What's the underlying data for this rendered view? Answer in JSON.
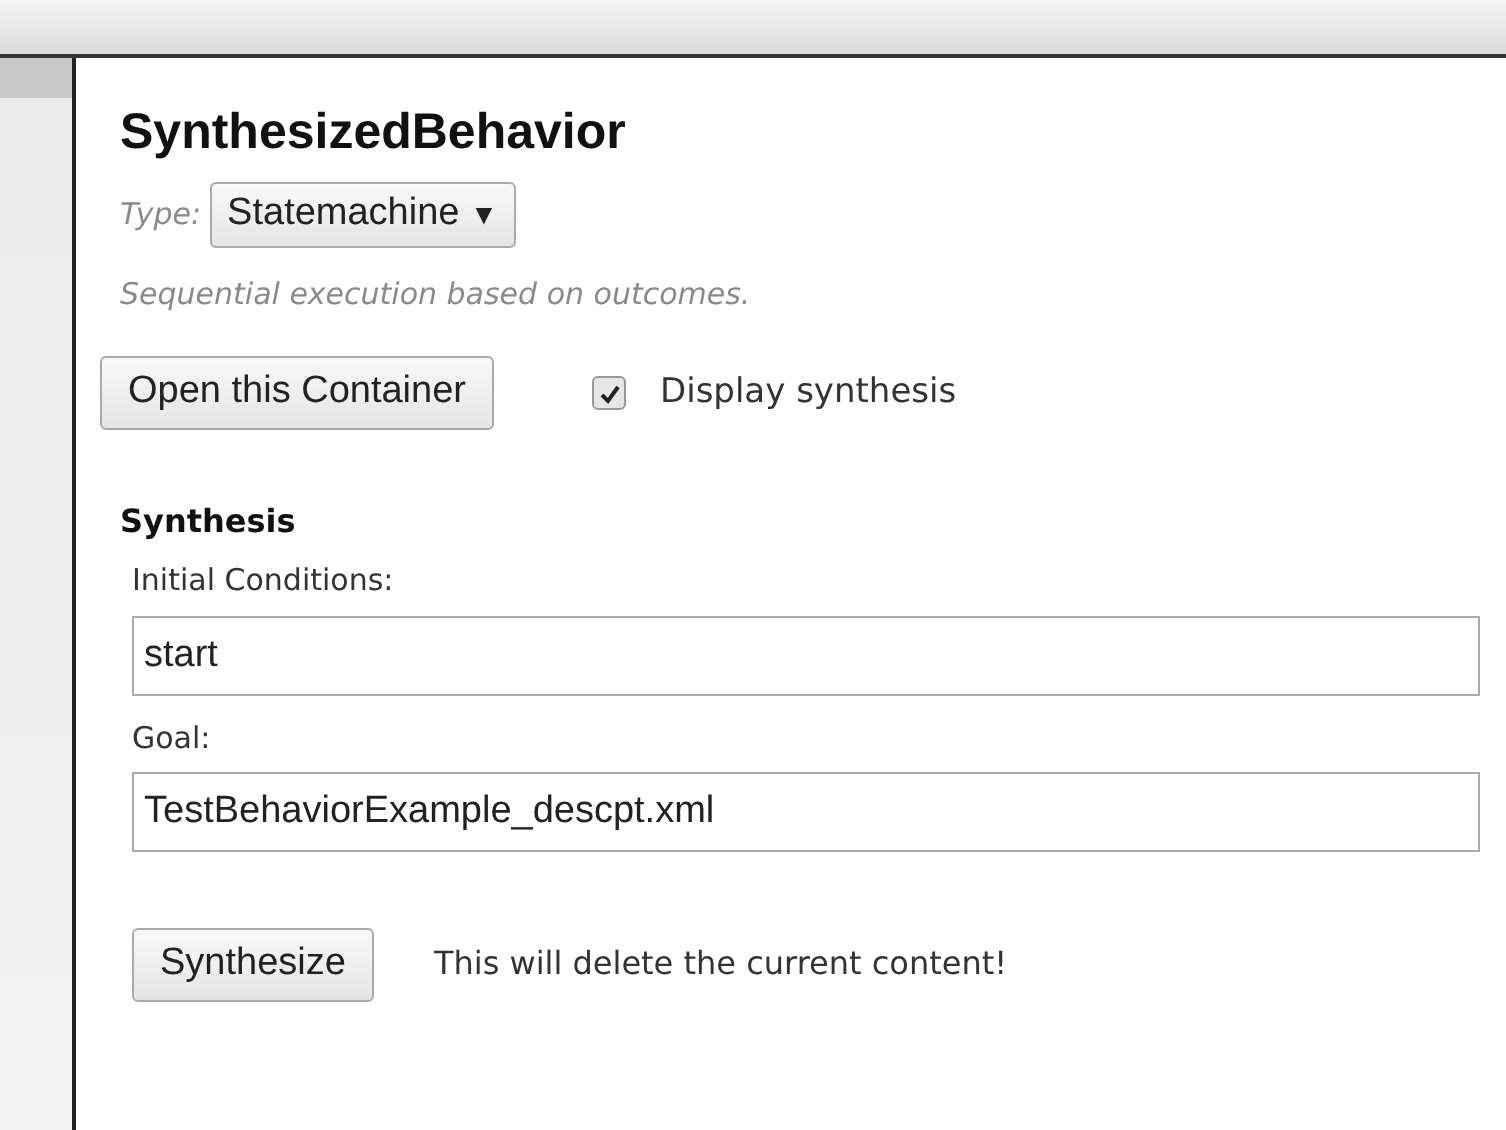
{
  "panel": {
    "title": "SynthesizedBehavior",
    "type_label": "Type:",
    "type_select": {
      "value": "Statemachine",
      "caret": "▼"
    },
    "type_description": "Sequential execution based on outcomes.",
    "open_button": "Open this Container",
    "display_synthesis": {
      "label": "Display synthesis",
      "checked": true
    },
    "synthesis": {
      "heading": "Synthesis",
      "fields": [
        {
          "label": "Initial Conditions:",
          "value": "start"
        },
        {
          "label": "Goal:",
          "value": "TestBehaviorExample_descpt.xml"
        }
      ],
      "button": "Synthesize",
      "warning": "This will delete the current content!"
    }
  }
}
